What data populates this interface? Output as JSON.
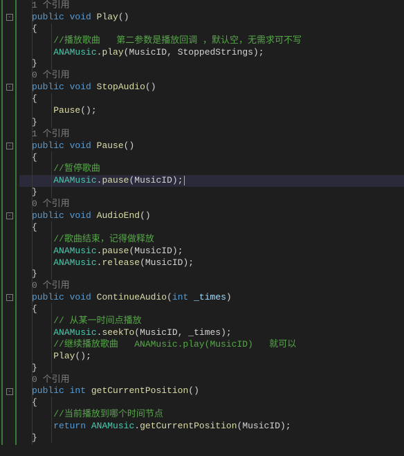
{
  "refs": {
    "one": "1 个引用",
    "zero": "0 个引用"
  },
  "kw": {
    "public": "public",
    "void": "void",
    "int": "int",
    "return": "return"
  },
  "methods": {
    "Play": "Play",
    "StopAudio": "StopAudio",
    "Pause": "Pause",
    "AudioEnd": "AudioEnd",
    "ContinueAudio": "ContinueAudio",
    "getCurrentPosition": "getCurrentPosition"
  },
  "cls": {
    "ANAMusic": "ANAMusic"
  },
  "calls": {
    "play": "play",
    "pause": "pause",
    "release": "release",
    "seekTo": "seekTo",
    "getCurrentPosition": "getCurrentPosition",
    "PauseCall": "Pause",
    "PlayCall": "Play"
  },
  "ids": {
    "MusicID": "MusicID",
    "StoppedStrings": "StoppedStrings",
    "_times": "_times"
  },
  "comments": {
    "playSong": "//播放歌曲   第二参数是播放回调 ，默认空，无需求可不写",
    "pauseSong": "//暂停歌曲",
    "songEnd": "//歌曲结束，记得做释放",
    "seekFrom": "// 从某一时间点播放",
    "continuePlay": "//继续播放歌曲   ANAMusic.play(MusicID)   就可以",
    "currentPos": "//当前播放到哪个时间节点"
  },
  "punc": {
    "lparen": "(",
    "rparen": ")",
    "lbrace": "{",
    "rbrace": "}",
    "semi": ";",
    "comma": ", ",
    "dot": "."
  }
}
